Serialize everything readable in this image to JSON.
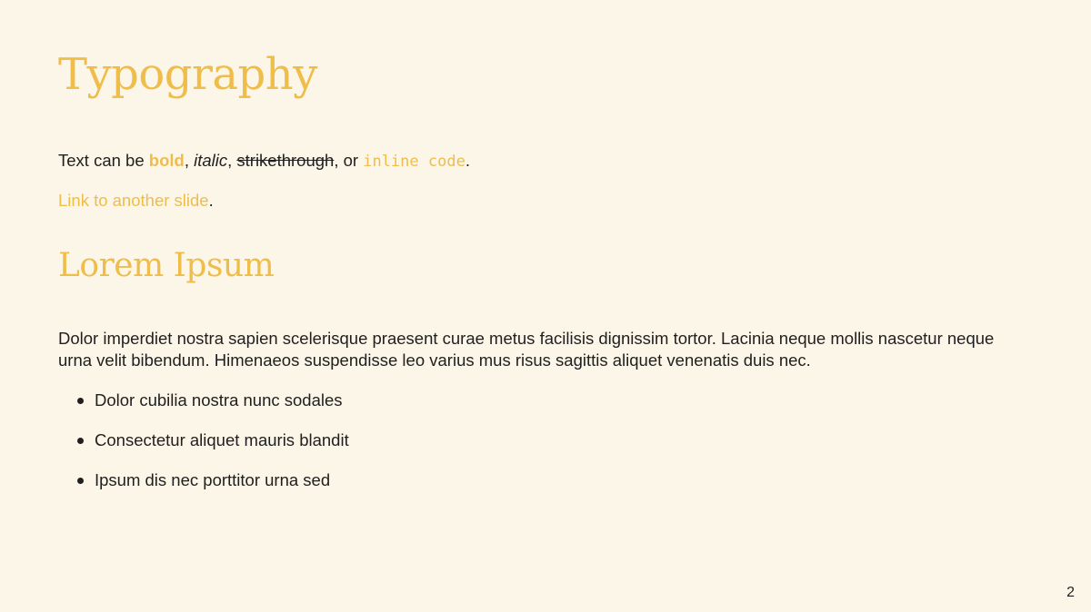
{
  "slide": {
    "title": "Typography",
    "text_line": {
      "prefix": "Text can be ",
      "bold": "bold",
      "sep1": ", ",
      "italic": "italic",
      "sep2": ", ",
      "strikethrough": "strikethrough",
      "sep3": ", or ",
      "code": "inline code",
      "suffix": "."
    },
    "link_line": {
      "link": "Link to another slide",
      "suffix": "."
    },
    "section_title": "Lorem Ipsum",
    "paragraph": "Dolor imperdiet nostra sapien scelerisque praesent curae metus facilisis dignissim tortor. Lacinia neque mollis nascetur neque urna velit bibendum. Himenaeos suspendisse leo varius mus risus sagittis aliquet venenatis duis nec.",
    "bullets": [
      "Dolor cubilia nostra nunc sodales",
      "Consectetur aliquet mauris blandit",
      "Ipsum dis nec porttitor urna sed"
    ],
    "page_number": "2"
  },
  "colors": {
    "background": "#fcf6e8",
    "accent": "#eebd4a",
    "text": "#1f1f1f"
  }
}
